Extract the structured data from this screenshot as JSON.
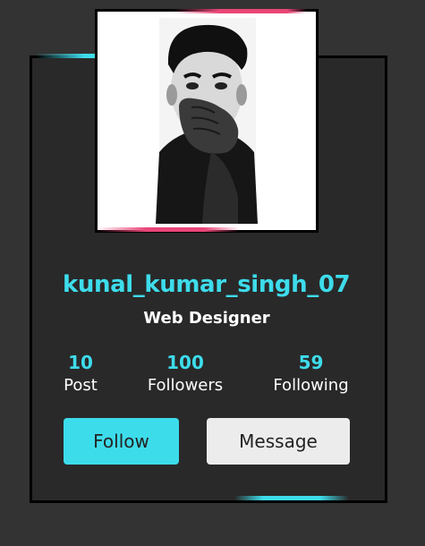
{
  "profile": {
    "username": "kunal_kumar_singh_07",
    "role": "Web Designer"
  },
  "stats": [
    {
      "value": "10",
      "label": "Post"
    },
    {
      "value": "100",
      "label": "Followers"
    },
    {
      "value": "59",
      "label": "Following"
    }
  ],
  "actions": {
    "follow_label": "Follow",
    "message_label": "Message"
  },
  "colors": {
    "background": "#333333",
    "card": "#292929",
    "accent_cyan": "#3ddceb",
    "accent_pink": "#e94678",
    "follow_button": "#3ddceb",
    "message_button": "#ececec"
  }
}
